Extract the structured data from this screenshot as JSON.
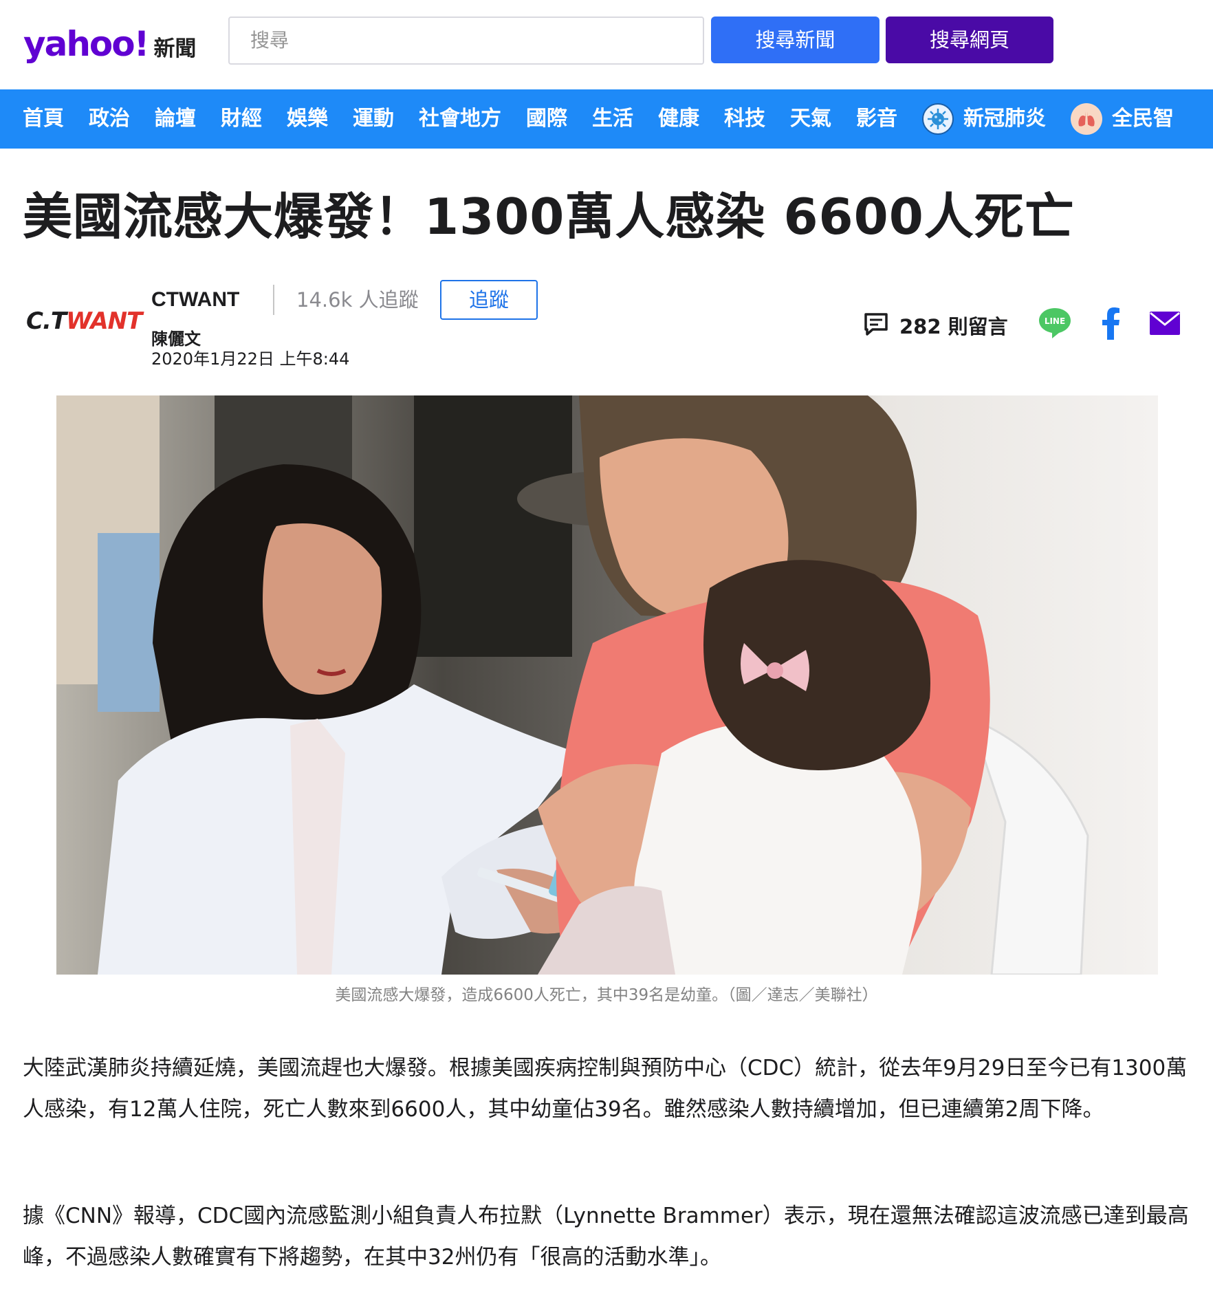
{
  "header": {
    "logo_main": "yahoo!",
    "logo_sub": "新聞",
    "search_placeholder": "搜尋",
    "search_news_label": "搜尋新聞",
    "search_web_label": "搜尋網頁"
  },
  "nav": {
    "items": [
      {
        "label": "首頁"
      },
      {
        "label": "政治"
      },
      {
        "label": "論壇"
      },
      {
        "label": "財經"
      },
      {
        "label": "娛樂"
      },
      {
        "label": "運動"
      },
      {
        "label": "社會地方"
      },
      {
        "label": "國際"
      },
      {
        "label": "生活"
      },
      {
        "label": "健康"
      },
      {
        "label": "科技"
      },
      {
        "label": "天氣"
      },
      {
        "label": "影音"
      }
    ],
    "special_items": [
      {
        "label": "新冠肺炎",
        "icon": "virus-icon"
      },
      {
        "label": "全民智",
        "icon": "lung-icon"
      }
    ]
  },
  "article": {
    "title": "美國流感大爆發！1300萬人感染 6600人死亡",
    "publisher": {
      "logo_text_dark": "C.T",
      "logo_text_red": "WANT",
      "name": "CTWANT",
      "followers": "14.6k 人追蹤",
      "follow_label": "追蹤"
    },
    "author": "陳儷文",
    "date": "2020年1月22日 上午8:44",
    "comments": "282 則留言",
    "line_label": "LINE",
    "photo_caption": "美國流感大爆發，造成6600人死亡，其中39名是幼童。（圖／達志／美聯社）",
    "paragraphs": [
      "大陸武漢肺炎持續延燒，美國流趕也大爆發。根據美國疾病控制與預防中心（CDC）統計，從去年9月29日至今已有1300萬人感染，有12萬人住院，死亡人數來到6600人，其中幼童佔39名。雖然感染人數持續增加，但已連續第2周下降。",
      "據《CNN》報導，CDC國內流感監測小組負責人布拉默（Lynnette Brammer）表示，現在還無法確認這波流感已達到最高峰，不過感染人數確實有下將趨勢，在其中32州仍有「很高的活動水準」。"
    ]
  },
  "colors": {
    "nav_bg": "#1e8af8",
    "brand_purple": "#6001d2",
    "search_news_btn": "#2f6ff6",
    "search_web_btn": "#4a0aa6",
    "follow_blue": "#1e73e8",
    "line_green": "#4cc764",
    "facebook_blue": "#1877f2",
    "mail_purple": "#6001d2"
  }
}
